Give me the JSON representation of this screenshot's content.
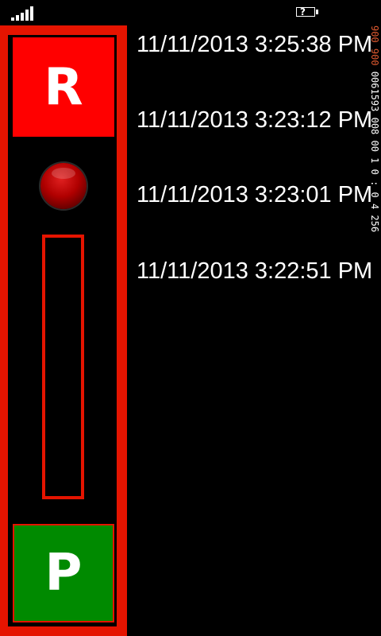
{
  "status_bar": {
    "signal_icon": "signal-strength-icon",
    "battery_icon": "battery-unknown-icon",
    "battery_glyph": "?"
  },
  "controls": {
    "record_label": "R",
    "play_label": "P",
    "indicator_icon": "record-led-icon",
    "panel_color": "#e51400",
    "record_color": "#ff0000",
    "play_color": "#008a00"
  },
  "recordings": [
    {
      "label": "11/11/2013 3:25:38 PM"
    },
    {
      "label": "11/11/2013 3:23:12 PM"
    },
    {
      "label": "11/11/2013 3:23:01 PM"
    },
    {
      "label": "11/11/2013 3:22:51 PM"
    }
  ],
  "debug_readout": {
    "highlight": "900 900",
    "text": " 0061593 008 00 1 0 : 0 4 256"
  }
}
